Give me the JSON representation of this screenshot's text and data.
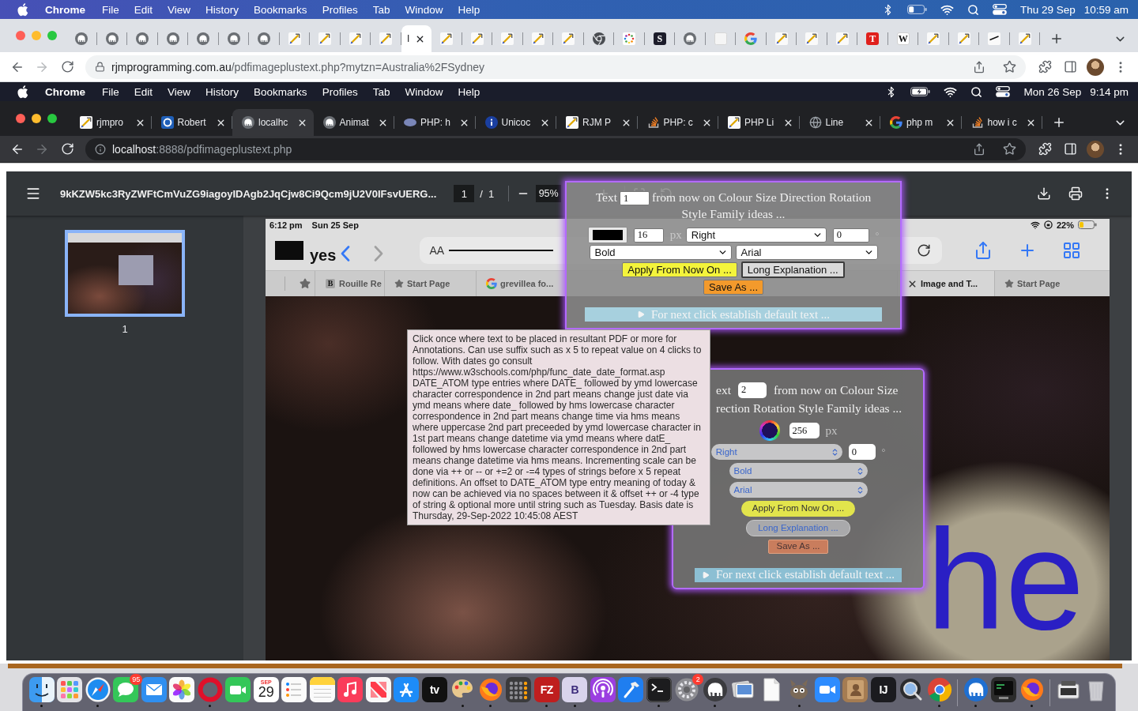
{
  "outer_menubar": {
    "menus": [
      "Chrome",
      "File",
      "Edit",
      "View",
      "History",
      "Bookmarks",
      "Profiles",
      "Tab",
      "Window",
      "Help"
    ],
    "charging": false,
    "date": "Thu 29 Sep",
    "time": "10:59 am"
  },
  "outer_tabs": [
    {
      "kind": "elephant",
      "selected": false
    },
    {
      "kind": "elephant",
      "selected": false
    },
    {
      "kind": "elephant",
      "selected": false
    },
    {
      "kind": "elephant",
      "selected": false
    },
    {
      "kind": "elephant",
      "selected": false
    },
    {
      "kind": "elephant",
      "selected": false
    },
    {
      "kind": "elephant",
      "selected": false
    },
    {
      "kind": "pen",
      "selected": false
    },
    {
      "kind": "pen",
      "selected": false
    },
    {
      "kind": "pen",
      "selected": false
    },
    {
      "kind": "pen",
      "selected": false
    },
    {
      "kind": "none",
      "title": "I",
      "selected": true
    },
    {
      "kind": "pen",
      "selected": false
    },
    {
      "kind": "pen",
      "selected": false
    },
    {
      "kind": "pen",
      "selected": false
    },
    {
      "kind": "pen",
      "selected": false
    },
    {
      "kind": "pen",
      "selected": false
    },
    {
      "kind": "aperture",
      "selected": false
    },
    {
      "kind": "dots",
      "selected": false
    },
    {
      "kind": "letter",
      "letter": "S",
      "color": "#1c1c2a",
      "selected": false
    },
    {
      "kind": "elephant",
      "selected": false
    },
    {
      "kind": "blank",
      "selected": false
    },
    {
      "kind": "google",
      "selected": false
    },
    {
      "kind": "pen",
      "selected": false
    },
    {
      "kind": "pen",
      "selected": false
    },
    {
      "kind": "pen",
      "selected": false
    },
    {
      "kind": "letter",
      "letter": "T",
      "color": "#e0201c",
      "selected": false
    },
    {
      "kind": "letter",
      "letter": "W",
      "color": "#ffffff",
      "selected": false
    },
    {
      "kind": "pen",
      "selected": false
    },
    {
      "kind": "pen",
      "selected": false
    },
    {
      "kind": "line",
      "selected": false
    },
    {
      "kind": "pen",
      "selected": false
    }
  ],
  "outer_address": {
    "forward_disabled": true,
    "host": "rjmprogramming.com.au",
    "path": "/pdfimageplustext.php?mytzn=Australia%2FSydney"
  },
  "inner_menubar": {
    "menus": [
      "Chrome",
      "File",
      "Edit",
      "View",
      "History",
      "Bookmarks",
      "Profiles",
      "Tab",
      "Window",
      "Help"
    ],
    "charging": true,
    "date": "Mon 26 Sep",
    "time": "9:14 pm"
  },
  "inner_tabs": [
    {
      "kind": "pen",
      "title": "rjmpro",
      "selected": false
    },
    {
      "kind": "ring",
      "title": "Robert",
      "selected": false
    },
    {
      "kind": "elephant",
      "title": "localhc",
      "selected": true
    },
    {
      "kind": "elephant",
      "title": "Animat",
      "selected": false
    },
    {
      "kind": "oval",
      "title": "PHP: h",
      "selected": false
    },
    {
      "kind": "info",
      "title": "Unicoc",
      "selected": false
    },
    {
      "kind": "pen",
      "title": "RJM P",
      "selected": false
    },
    {
      "kind": "stack",
      "title": "PHP: c",
      "selected": false
    },
    {
      "kind": "pen",
      "title": "PHP Li",
      "selected": false
    },
    {
      "kind": "globe",
      "title": "Line",
      "selected": false
    },
    {
      "kind": "google",
      "title": "php m",
      "selected": false
    },
    {
      "kind": "stack",
      "title": "how i c",
      "selected": false
    }
  ],
  "inner_address": {
    "forward_disabled": true,
    "host": "localhost",
    "path": ":8888/pdfimageplustext.php"
  },
  "pdf_toolbar": {
    "title": "9kKZW5kc3RyZWFtCmVuZG9iagoyIDAgb2JqCjw8Ci9Qcm9jU2V0IFsvUERG...",
    "page": "1",
    "separator": "/",
    "page_count": "1",
    "zoom": "95%"
  },
  "sidebar": {
    "thumbnails": [
      {
        "label": "1",
        "selected": true
      }
    ]
  },
  "page": {
    "status": {
      "time": "6:12 pm",
      "date": "Sun 25 Sep",
      "battery": "22%"
    },
    "toolbar": {
      "note": "yes",
      "reader_label": "AA"
    },
    "tabs": [
      {
        "kind": "letter",
        "letter": "B",
        "color": "#a3a3a3",
        "title": "Rouille Re",
        "selected": false
      },
      {
        "kind": "star",
        "title": "Start Page",
        "selected": false
      },
      {
        "kind": "google",
        "title": "grevillea fo...",
        "selected": false
      },
      {
        "title": "Image and T...",
        "selected": true
      },
      {
        "kind": "star",
        "title": "Start Page",
        "selected": false
      }
    ],
    "overlay_text": "he"
  },
  "dialog_1": {
    "label": "Text",
    "text_value": "1",
    "prompt": "from now on Colour Size Direction Rotation Style Family ideas ...",
    "color": "#000000",
    "size_value": "16",
    "size_unit": "px",
    "direction": "Right",
    "rotation_value": "0",
    "rotation_unit": "°",
    "style": "Bold",
    "family": "Arial",
    "button_rows": [
      [
        {
          "kind": "apply",
          "label": "Apply From Now On ..."
        },
        {
          "kind": "explain",
          "label": "Long Explanation ..."
        }
      ],
      [
        {
          "kind": "save",
          "label": "Save As ..."
        }
      ]
    ],
    "summary": "For next click establish default text ..."
  },
  "tooltip": {
    "text": "Click once where text to be placed in resultant PDF or more for Annotations. Can use suffix such as x 5 to repeat value on 4 clicks to follow. With dates go consult https://www.w3schools.com/php/func_date_date_format.asp DATE_ATOM type entries where DATE_ followed by ymd lowercase character correspondence in 2nd part means change just date via ymd means where date_ followed by hms lowercase character correspondence in 2nd part means change time via hms means where uppercase 2nd part preceeded by ymd lowercase character in 1st part means change datetime via ymd means where datE_ followed by hms lowercase character correspondence in 2nd part means change datetime via hms means. Incrementing scale can be done via ++ or -- or +=2 or -=4 types of strings before x 5 repeat definitions. An offset to DATE_ATOM type entry meaning of today & now can be achieved via no spaces between it & offset ++ or -4 type of string & optional more until string such as Tuesday. Basis date is Thursday, 29-Sep-2022 10:45:08 AEST"
  },
  "dialog_2": {
    "label": "ext",
    "text_value": "2",
    "prompt_lines": [
      "from now on Colour Size",
      "rection Rotation Style Family ideas ..."
    ],
    "color": "#1e0f5a",
    "size_value": "256",
    "size_unit": "px",
    "direction": "Right",
    "rotation_value": "0",
    "rotation_unit": "°",
    "style": "Bold",
    "family": "Arial",
    "button_rows": [
      [
        {
          "kind": "apply",
          "label": "Apply From Now On ..."
        }
      ],
      [
        {
          "kind": "explain",
          "label": "Long Explanation ..."
        }
      ],
      [
        {
          "kind": "save",
          "label": "Save As ..."
        }
      ]
    ],
    "summary": "For next click establish default text ..."
  },
  "dock": {
    "items": [
      {
        "kind": "face",
        "running": true
      },
      {
        "kind": "grid",
        "running": false
      },
      {
        "kind": "compass",
        "running": true
      },
      {
        "kind": "bubble",
        "badge": "95",
        "running": false
      },
      {
        "kind": "envelope",
        "running": false
      },
      {
        "kind": "flower",
        "running": false
      },
      {
        "kind": "ring",
        "running": true
      },
      {
        "kind": "camera",
        "running": false
      },
      {
        "kind": "calendar",
        "month": "SEP",
        "day": "29",
        "running": false
      },
      {
        "kind": "checklist",
        "running": false
      },
      {
        "kind": "notepad",
        "running": false
      },
      {
        "kind": "note",
        "running": false
      },
      {
        "kind": "ribbon",
        "running": false
      },
      {
        "kind": "strokes",
        "running": false
      },
      {
        "kind": "label",
        "label": "tv",
        "color": "#111111",
        "running": false
      },
      {
        "kind": "palette",
        "running": true
      },
      {
        "kind": "fox",
        "running": true
      },
      {
        "kind": "calculator",
        "running": false
      },
      {
        "kind": "label",
        "label": "FZ",
        "color": "#bf1e1e",
        "running": true
      },
      {
        "kind": "label",
        "label": "B",
        "color": "#d9d4ec",
        "running": true
      },
      {
        "kind": "podcast",
        "running": false
      },
      {
        "kind": "hammer",
        "running": false
      },
      {
        "kind": "terminal",
        "running": true
      },
      {
        "kind": "gear",
        "badge": "2",
        "running": false
      },
      {
        "kind": "elephant",
        "running": true
      },
      {
        "kind": "photos",
        "running": false
      },
      {
        "kind": "document",
        "running": false
      },
      {
        "kind": "critter",
        "running": true
      },
      {
        "kind": "videocall",
        "running": false
      },
      {
        "kind": "book",
        "running": false
      },
      {
        "kind": "label",
        "label": "IJ",
        "color": "#1b1b1f",
        "running": false
      },
      {
        "kind": "lens",
        "running": false
      },
      {
        "kind": "browser",
        "running": true
      },
      {
        "kind": "separator"
      },
      {
        "kind": "elephant2",
        "running": true
      },
      {
        "kind": "console",
        "running": false
      },
      {
        "kind": "fox",
        "running": true
      },
      {
        "kind": "separator"
      },
      {
        "kind": "tray",
        "running": false
      },
      {
        "kind": "trash",
        "running": false
      }
    ]
  }
}
